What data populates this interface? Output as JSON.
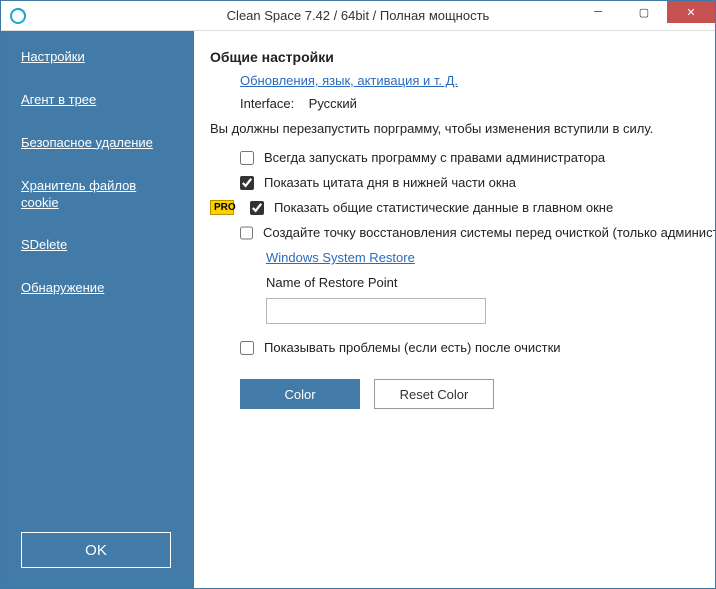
{
  "window": {
    "title": "Clean Space 7.42 / 64bit / Полная мощность"
  },
  "sidebar": {
    "items": [
      "Настройки",
      "Агент в трее",
      "Безопасное удаление",
      "Хранитель файлов cookie",
      "SDelete",
      "Обнаружение"
    ],
    "ok": "OK"
  },
  "content": {
    "heading": "Общие настройки",
    "updates_link": "Обновления, язык, активация и т. Д.",
    "interface_label": "Interface:",
    "interface_value": "Русский",
    "restart_note": "Вы должны перезапустить порграмму, чтобы изменения вступили в силу.",
    "options": {
      "admin": {
        "label": "Всегда запускать программу с правами администратора",
        "checked": false
      },
      "quote": {
        "label": "Показать цитата дня в нижней части окна",
        "checked": true
      },
      "stats": {
        "label": "Показать общие статистические данные в главном окне",
        "checked": true,
        "pro": "PRO"
      },
      "restore": {
        "label": "Создайте точку восстановления системы перед очисткой (только администраторы)",
        "checked": false
      },
      "problems": {
        "label": "Показывать проблемы (если есть) после очистки",
        "checked": false
      }
    },
    "restore_link": "Windows System Restore",
    "restore_name_label": "Name of Restore Point",
    "restore_name_value": "",
    "color_btn": "Color",
    "reset_color_btn": "Reset Color"
  }
}
